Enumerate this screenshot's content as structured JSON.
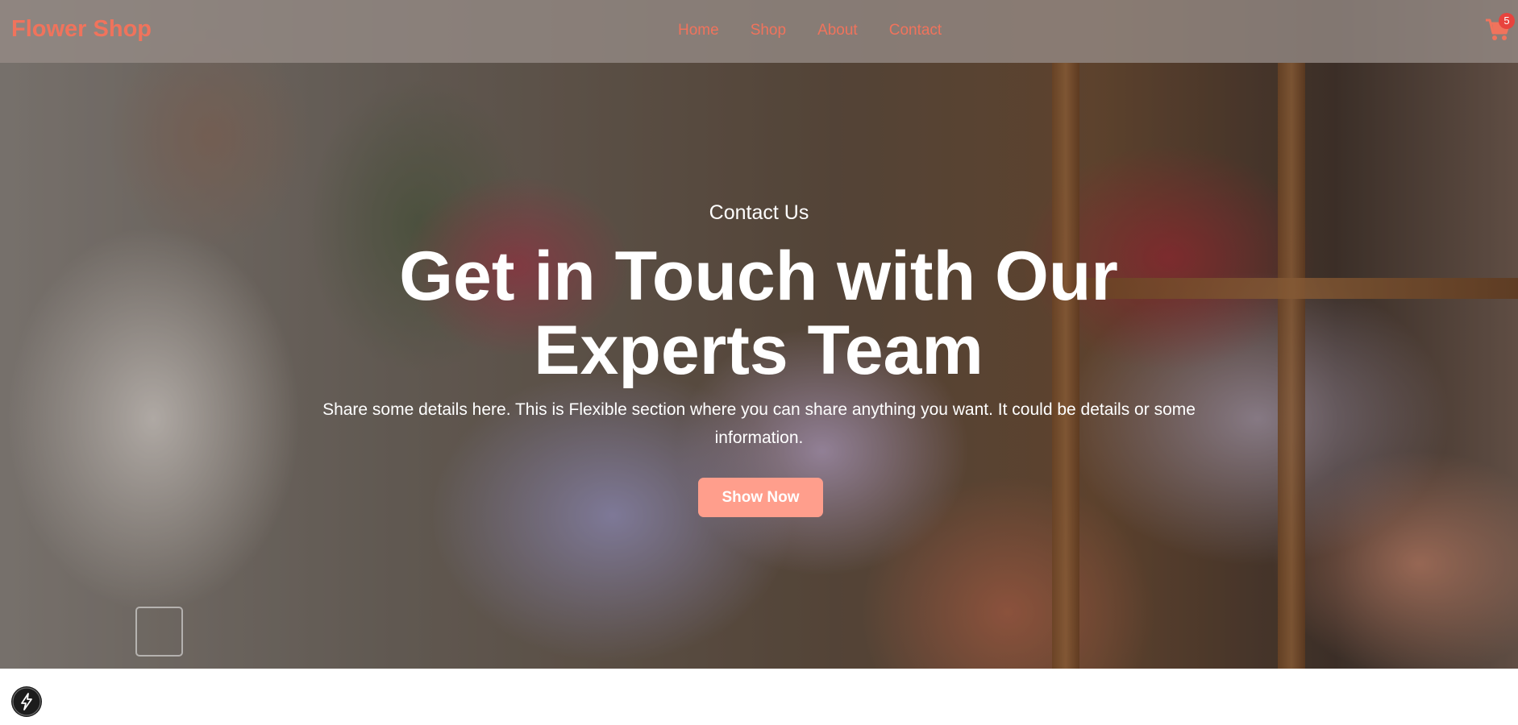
{
  "navbar": {
    "brand": "Flower Shop",
    "links": [
      "Home",
      "Shop",
      "About",
      "Contact"
    ],
    "cart_icon": "shopping-cart-icon",
    "cart_count": "5"
  },
  "hero": {
    "eyebrow": "Contact Us",
    "headline": "Get in Touch with Our Experts Team",
    "subtext": "Share some details here. This is Flexible section where you can share anything you want. It could be details or some information.",
    "cta_label": "Show Now"
  },
  "colors": {
    "accent": "#f0735c",
    "button": "#ff9e8c",
    "badge": "#e8433d"
  },
  "floating_button_icon": "lightning-bolt-icon"
}
